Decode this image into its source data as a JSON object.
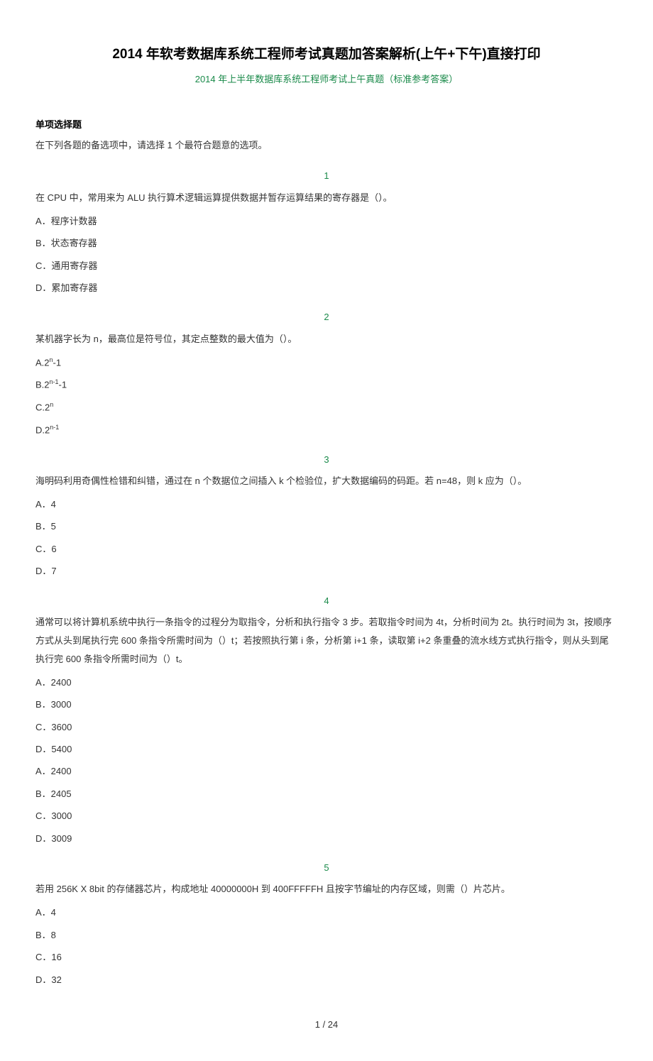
{
  "header": {
    "title": "2014 年软考数据库系统工程师考试真题加答案解析(上午+下午)直接打印",
    "subtitle": "2014 年上半年数据库系统工程师考试上午真题（标准参考答案）"
  },
  "section": {
    "heading": "单项选择题",
    "instruction": "在下列各题的备选项中，请选择 1 个最符合题意的选项。"
  },
  "questions": [
    {
      "number": "1",
      "text": "在 CPU 中，常用来为 ALU 执行算术逻辑运算提供数据并暂存运算结果的寄存器是（）。",
      "options": [
        "A．程序计数器",
        "B．状态寄存器",
        "C．通用寄存器",
        "D．累加寄存器"
      ]
    },
    {
      "number": "2",
      "text": "某机器字长为 n，最高位是符号位，其定点整数的最大值为（）。",
      "options_html": [
        "A.2<sup>n</sup>-1",
        "B.2<sup>n-1</sup>-1",
        "C.2<sup>n</sup>",
        "D.2<sup>n-1</sup>"
      ]
    },
    {
      "number": "3",
      "text": "海明码利用奇偶性检错和纠错，通过在 n 个数据位之间插入 k 个检验位，扩大数据编码的码距。若 n=48，则 k 应为（）。",
      "options": [
        "A．4",
        "B．5",
        "C．6",
        "D．7"
      ]
    },
    {
      "number": "4",
      "text": "通常可以将计算机系统中执行一条指令的过程分为取指令，分析和执行指令 3 步。若取指令时间为 4t，分析时间为 2t。执行时间为 3t，按顺序方式从头到尾执行完 600 条指令所需时间为（）t；若按照执行第 i 条，分析第 i+1 条，读取第 i+2 条重叠的流水线方式执行指令，则从头到尾执行完 600 条指令所需时间为（）t。",
      "options": [
        "A．2400",
        "B．3000",
        "C．3600",
        "D．5400",
        "A．2400",
        "B．2405",
        "C．3000",
        "D．3009"
      ]
    },
    {
      "number": "5",
      "text": "若用 256K X 8bit 的存储器芯片，构成地址 40000000H 到 400FFFFFH 且按字节编址的内存区域，则需（）片芯片。",
      "options": [
        "A．4",
        "B．8",
        "C．16",
        "D．32"
      ]
    }
  ],
  "footer": {
    "page": "1 / 24"
  }
}
